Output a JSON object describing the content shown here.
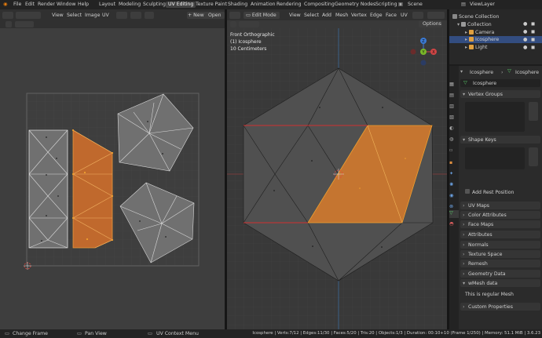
{
  "topbar": {
    "menus": [
      "File",
      "Edit",
      "Render",
      "Window",
      "Help"
    ],
    "workspaces": [
      "Layout",
      "Modeling",
      "Sculpting",
      "UV Editing",
      "Texture Paint",
      "Shading",
      "Animation",
      "Rendering",
      "Compositing",
      "Geometry Nodes",
      "Scripting"
    ],
    "active_workspace": "UV Editing",
    "scene": "Scene",
    "view_layer": "ViewLayer"
  },
  "uv_editor": {
    "menus": [
      "View",
      "Select",
      "Image",
      "UV"
    ],
    "new_label": "New",
    "open_label": "Open"
  },
  "viewport": {
    "mode": "Edit Mode",
    "menus": [
      "View",
      "Select",
      "Add",
      "Mesh",
      "Vertex",
      "Edge",
      "Face",
      "UV"
    ],
    "options_label": "Options",
    "overlay": {
      "line1": "Front Orthographic",
      "line2": "(1) Icosphere",
      "line3": "10 Centimeters"
    },
    "gizmo": {
      "z": "Z",
      "y": "Y",
      "x": "X"
    }
  },
  "outliner": {
    "items": [
      {
        "label": "Scene Collection"
      },
      {
        "label": "Collection"
      },
      {
        "label": "Camera"
      },
      {
        "label": "Icosphere"
      },
      {
        "label": "Light"
      }
    ]
  },
  "properties": {
    "object_name": "Icosphere",
    "object_name2": "Icosphere",
    "mesh_name": "Icosphere",
    "vertex_groups": "Vertex Groups",
    "shape_keys": "Shape Keys",
    "add_rest_position": "Add Rest Position",
    "sections": [
      "UV Maps",
      "Color Attributes",
      "Face Maps",
      "Attributes",
      "Normals",
      "Texture Space",
      "Remesh",
      "Geometry Data",
      "wMesh data"
    ],
    "wmesh_text": "This is regular Mesh",
    "custom_properties": "Custom Properties"
  },
  "statusbar": {
    "left1": "Change Frame",
    "left2": "Pan View",
    "left3": "UV Context Menu",
    "stats": "Icosphere | Verts:7/12 | Edges:11/30 | Faces:5/20 | Tris:20 | Objects:1/3 | Duration: 00:10+10 (Frame 1/250) | Memory: 51.1 MiB | 3.6.23"
  }
}
